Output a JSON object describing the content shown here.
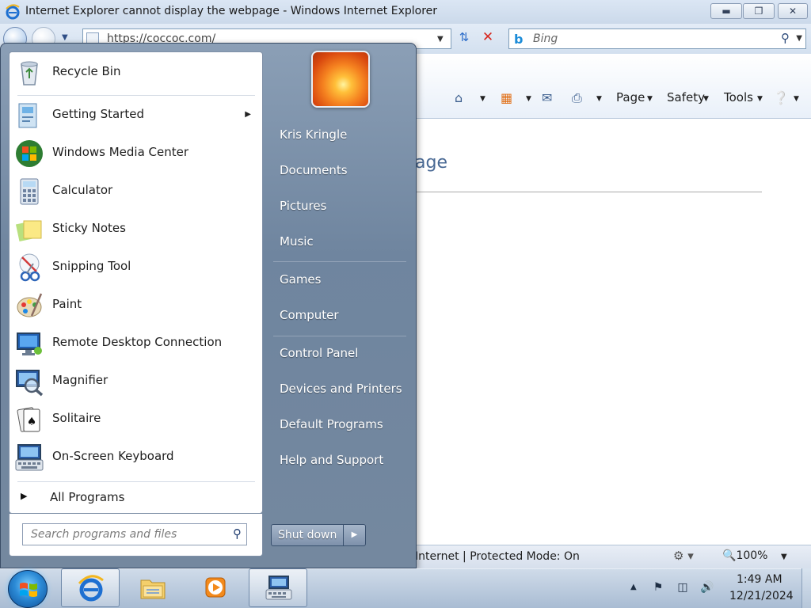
{
  "ie": {
    "title": "Internet Explorer cannot display the webpage - Windows Internet Explorer",
    "address": "https://coccoc.com/",
    "search_placeholder": "Bing",
    "commands": {
      "page": "Page",
      "safety": "Safety",
      "tools": "Tools"
    },
    "heading_fragment": "age",
    "status_text": "Internet | Protected Mode: On",
    "zoom": "100%"
  },
  "start_menu": {
    "pinned": [
      {
        "label": "Recycle Bin",
        "icon": "recycle-bin-icon"
      }
    ],
    "programs": [
      {
        "label": "Getting Started",
        "icon": "getting-started-icon",
        "submenu": true
      },
      {
        "label": "Windows Media Center",
        "icon": "media-center-icon"
      },
      {
        "label": "Calculator",
        "icon": "calculator-icon"
      },
      {
        "label": "Sticky Notes",
        "icon": "sticky-notes-icon"
      },
      {
        "label": "Snipping Tool",
        "icon": "scissors-icon"
      },
      {
        "label": "Paint",
        "icon": "paint-palette-icon"
      },
      {
        "label": "Remote Desktop Connection",
        "icon": "remote-desktop-icon"
      },
      {
        "label": "Magnifier",
        "icon": "magnifier-icon"
      },
      {
        "label": "Solitaire",
        "icon": "solitaire-icon"
      },
      {
        "label": "On-Screen Keyboard",
        "icon": "keyboard-icon"
      }
    ],
    "all_programs": "All Programs",
    "search_placeholder": "Search programs and files",
    "right_items": [
      "Kris Kringle",
      "Documents",
      "Pictures",
      "Music",
      "Games",
      "Computer",
      "Control Panel",
      "Devices and Printers",
      "Default Programs",
      "Help and Support"
    ],
    "shutdown": "Shut down"
  },
  "taskbar": {
    "apps": [
      {
        "name": "Internet Explorer",
        "icon": "internet-explorer-icon",
        "active": true
      },
      {
        "name": "Windows Explorer",
        "icon": "folder-icon",
        "active": false
      },
      {
        "name": "Windows Media Player",
        "icon": "media-player-icon",
        "active": false
      },
      {
        "name": "On-Screen Keyboard",
        "icon": "keyboard-icon",
        "active": true
      }
    ],
    "time": "1:49 AM",
    "date": "12/21/2024"
  }
}
